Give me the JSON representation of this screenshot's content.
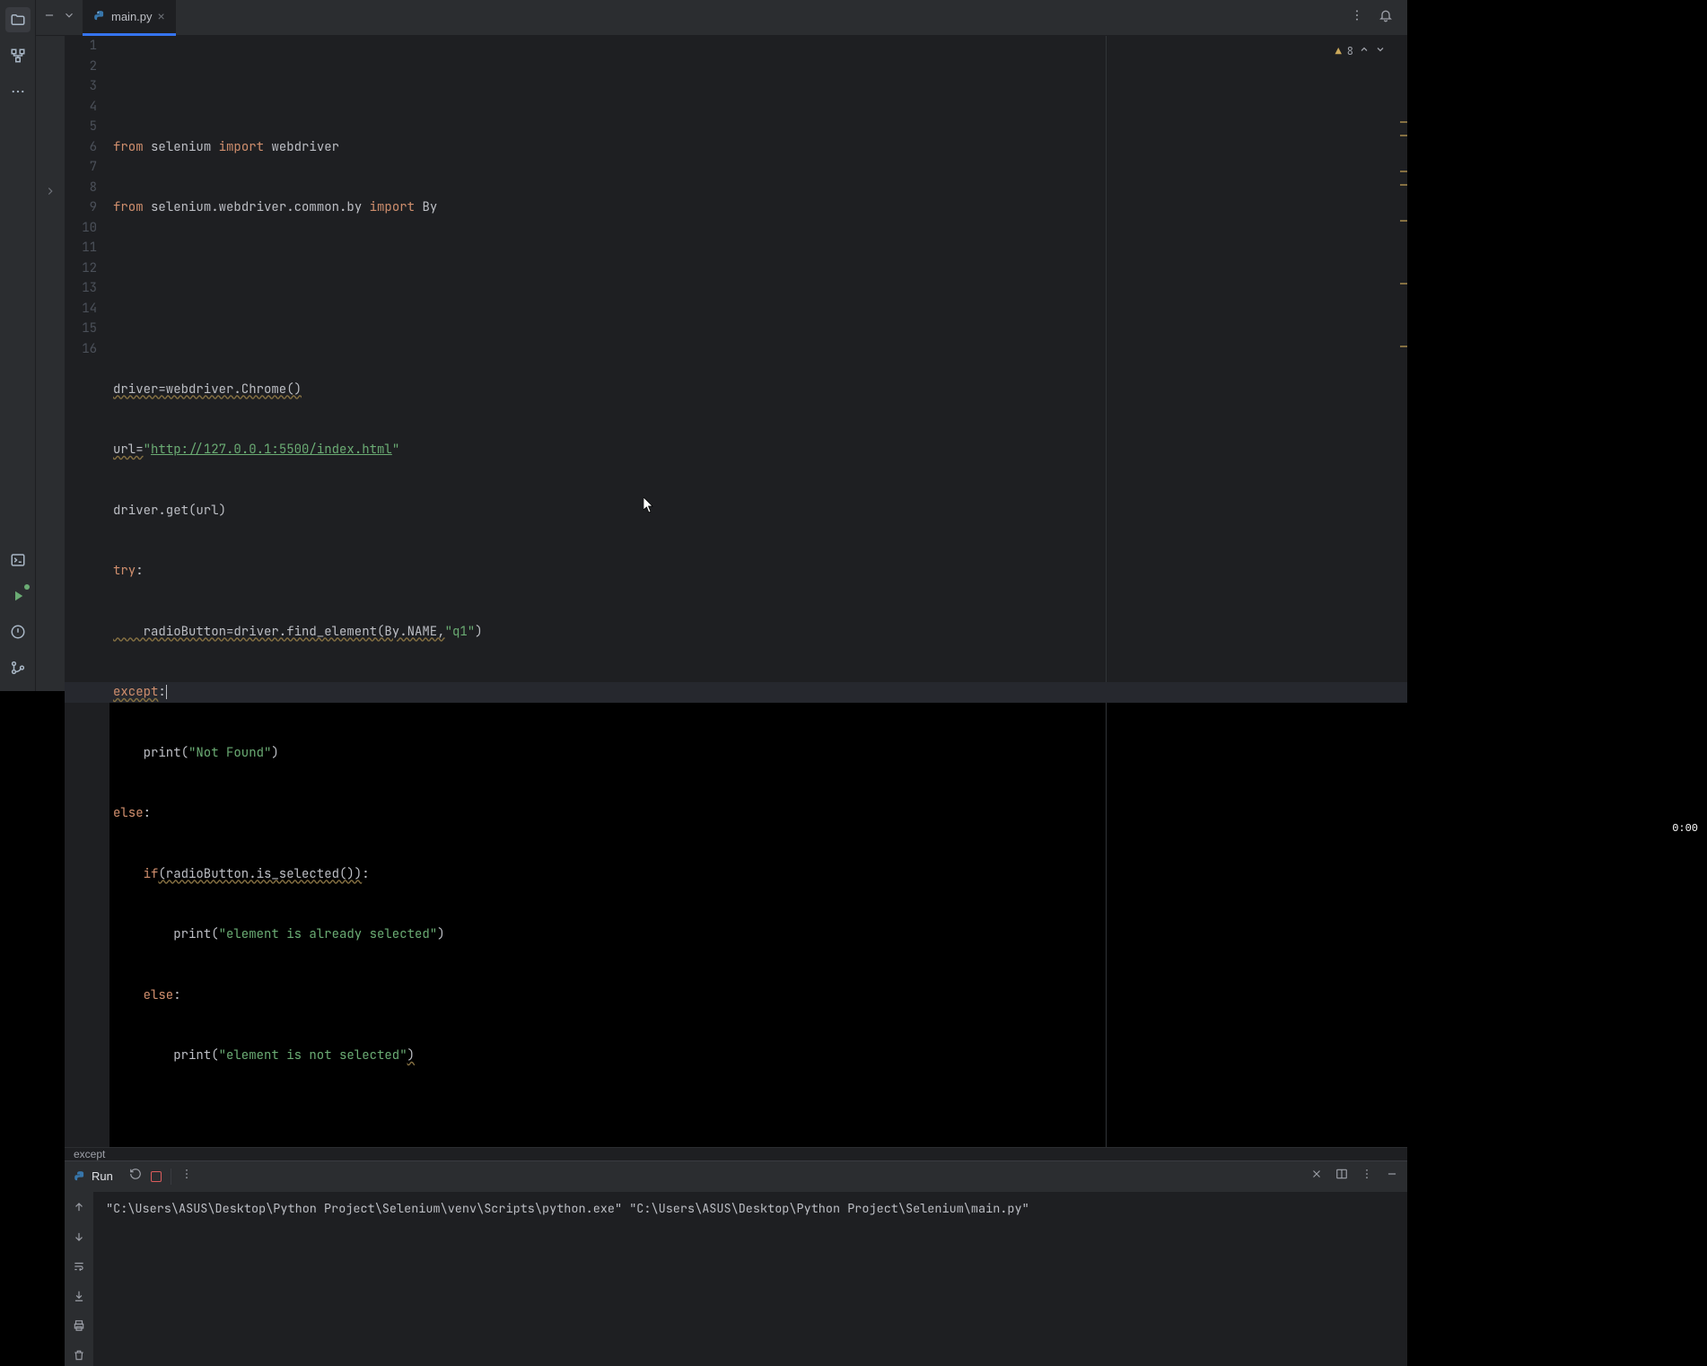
{
  "tab": {
    "filename": "main.py"
  },
  "inspections": {
    "warnings_count": "8"
  },
  "breadcrumb": "except",
  "code": {
    "lines": [
      {
        "n": "1"
      },
      {
        "n": "2"
      },
      {
        "n": "3"
      },
      {
        "n": "4"
      },
      {
        "n": "5"
      },
      {
        "n": "6"
      },
      {
        "n": "7"
      },
      {
        "n": "8"
      },
      {
        "n": "9"
      },
      {
        "n": "10"
      },
      {
        "n": "11"
      },
      {
        "n": "12"
      },
      {
        "n": "13"
      },
      {
        "n": "14"
      },
      {
        "n": "15"
      },
      {
        "n": "16"
      }
    ],
    "l1_from": "from",
    "l1_mod": "selenium",
    "l1_import": "import",
    "l1_name": "webdriver",
    "l2_from": "from",
    "l2_mod": "selenium.webdriver.common.by",
    "l2_import": "import",
    "l2_name": "By",
    "l5": "driver=webdriver.Chrome()",
    "l6_pre": "url=",
    "l6_q": "\"",
    "l6_url": "http://127.0.0.1:5500/index.html",
    "l6_q2": "\"",
    "l7": "driver.get(url)",
    "l8_try": "try",
    "l8_colon": ":",
    "l9_pre": "    radioButton=driver.find_element(By.NAME,",
    "l9_str": "\"q1\"",
    "l9_post": ")",
    "l10_except": "except",
    "l10_colon": ":",
    "l11_pre": "    print(",
    "l11_str": "\"Not Found\"",
    "l11_post": ")",
    "l12_else": "else",
    "l12_colon": ":",
    "l13_if": "    if",
    "l13_cond": "(radioButton.is_selected())",
    "l13_colon": ":",
    "l14_pre": "        print(",
    "l14_str": "\"element is already selected\"",
    "l14_post": ")",
    "l15_else": "    else",
    "l15_colon": ":",
    "l16_pre": "        print(",
    "l16_str": "\"element is not selected\"",
    "l16_post": ")"
  },
  "run": {
    "title": "Run",
    "output": "\"C:\\Users\\ASUS\\Desktop\\Python Project\\Selenium\\venv\\Scripts\\python.exe\" \"C:\\Users\\ASUS\\Desktop\\Python Project\\Selenium\\main.py\" "
  },
  "taskbar": {
    "time": "0:00"
  }
}
